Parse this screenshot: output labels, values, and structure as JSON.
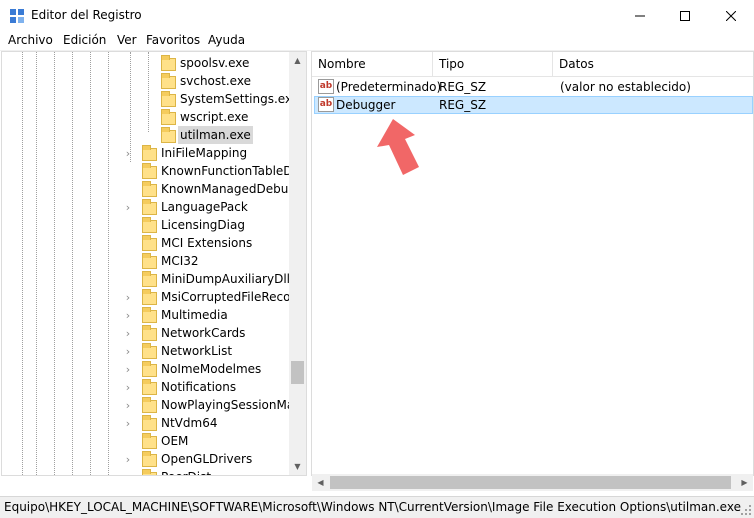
{
  "window": {
    "title": "Editor del Registro",
    "minimize_icon": "minimize-icon",
    "maximize_icon": "maximize-icon",
    "close_icon": "close-icon"
  },
  "menu": [
    "Archivo",
    "Edición",
    "Ver",
    "Favoritos",
    "Ayuda"
  ],
  "tree": {
    "children_of_selected_parent": [
      {
        "label": "spoolsv.exe"
      },
      {
        "label": "svchost.exe"
      },
      {
        "label": "SystemSettings.exe"
      },
      {
        "label": "wscript.exe"
      },
      {
        "label": "utilman.exe",
        "selected": true
      }
    ],
    "keys": [
      {
        "label": "IniFileMapping",
        "expandable": true
      },
      {
        "label": "KnownFunctionTableDlls",
        "expandable": false
      },
      {
        "label": "KnownManagedDebugg",
        "expandable": false
      },
      {
        "label": "LanguagePack",
        "expandable": true
      },
      {
        "label": "LicensingDiag",
        "expandable": false
      },
      {
        "label": "MCI Extensions",
        "expandable": false
      },
      {
        "label": "MCI32",
        "expandable": false
      },
      {
        "label": "MiniDumpAuxiliaryDlls",
        "expandable": false
      },
      {
        "label": "MsiCorruptedFileRecove",
        "expandable": true
      },
      {
        "label": "Multimedia",
        "expandable": true
      },
      {
        "label": "NetworkCards",
        "expandable": true
      },
      {
        "label": "NetworkList",
        "expandable": true
      },
      {
        "label": "NoImeModelmes",
        "expandable": true
      },
      {
        "label": "Notifications",
        "expandable": true
      },
      {
        "label": "NowPlayingSessionMana",
        "expandable": true
      },
      {
        "label": "NtVdm64",
        "expandable": true
      },
      {
        "label": "OEM",
        "expandable": false
      },
      {
        "label": "OpenGLDrivers",
        "expandable": true
      },
      {
        "label": "PeerDist",
        "expandable": true
      }
    ]
  },
  "list": {
    "columns": [
      "Nombre",
      "Tipo",
      "Datos"
    ],
    "rows": [
      {
        "icon": "ab",
        "name": "(Predeterminado)",
        "type": "REG_SZ",
        "data": "(valor no establecido)",
        "selected": false
      },
      {
        "icon": "ab",
        "name": "Debugger",
        "type": "REG_SZ",
        "data": "",
        "selected": true
      }
    ]
  },
  "status": {
    "path": "Equipo\\HKEY_LOCAL_MACHINE\\SOFTWARE\\Microsoft\\Windows NT\\CurrentVersion\\Image File Execution Options\\utilman.exe"
  },
  "colors": {
    "selection_bg": "#cce8ff",
    "selection_border": "#99d1ff",
    "annotation_arrow": "#f05a5a"
  }
}
